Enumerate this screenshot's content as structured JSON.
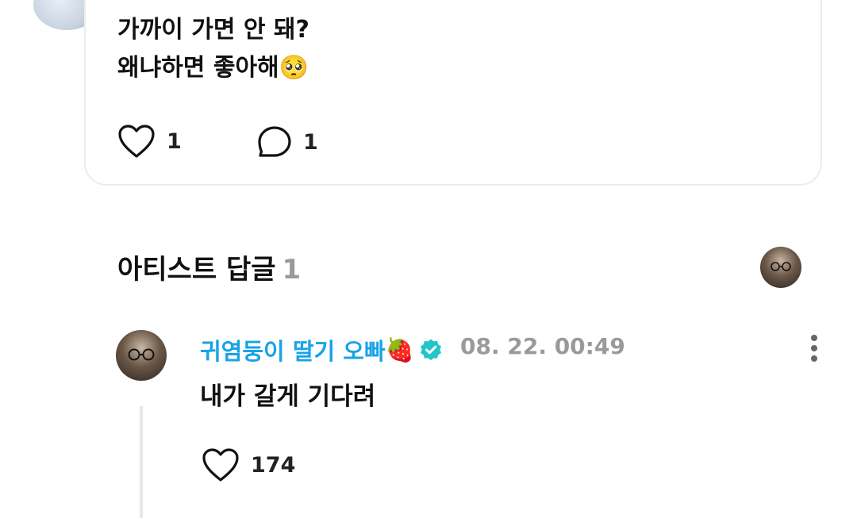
{
  "post": {
    "text_line1": "가까이 가면 안 돼?",
    "text_line2": "왜냐하면 좋아해🥺",
    "like_count": "1",
    "comment_count": "1"
  },
  "artist_replies": {
    "title": "아티스트 답글",
    "count": "1"
  },
  "reply": {
    "author": "귀염둥이 딸기 오빠",
    "author_emoji": "🍓",
    "timestamp": "08. 22. 00:49",
    "text": "내가 갈게 기다려",
    "like_count": "174"
  },
  "colors": {
    "author_name": "#18a3e6",
    "verified_badge": "#23c6c8",
    "muted_text": "#9a9a9a"
  },
  "icons": [
    "heart-icon",
    "comment-icon",
    "verified-badge-icon",
    "more-options-icon"
  ]
}
